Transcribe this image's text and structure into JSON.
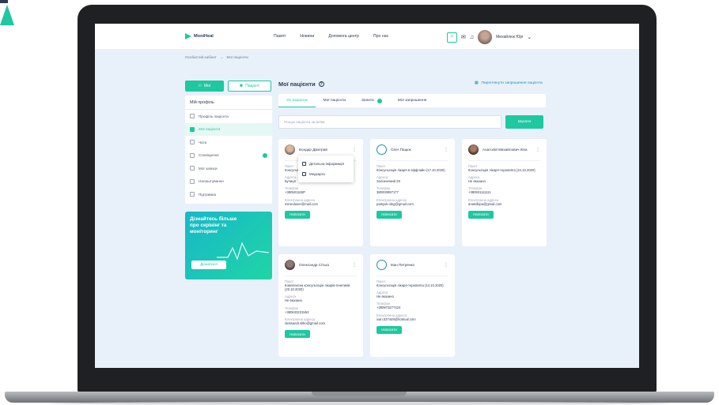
{
  "topbar": {
    "brand": "MoniHeal",
    "nav": [
      "Пакеті",
      "Новини",
      "Допомога центр",
      "Про нас"
    ],
    "user_name": "Михайлюк Юрі"
  },
  "breadcrumb": [
    "Особистий кабінет",
    "Мої пацієнти"
  ],
  "sidebar": {
    "btn_add": "Мої",
    "btn_second": "Пацієнт",
    "menu_title": "Мій профіль",
    "items": [
      {
        "label": "Профіль пацієнта",
        "active": false
      },
      {
        "label": "Мої пацієнти",
        "active": true
      },
      {
        "label": "Чати",
        "active": false
      },
      {
        "label": "Сповіщення",
        "active": false
      },
      {
        "label": "Мої записи",
        "active": false
      },
      {
        "label": "Налаштування",
        "active": false
      },
      {
        "label": "Підтримка",
        "active": false
      }
    ],
    "promo_title": "Дізнайтесь більше про скрінінг та моніторинг",
    "promo_button": "Дізнатися"
  },
  "main": {
    "title": "Мої пацієнти",
    "link": "Переглянути запрошення пацієнта",
    "tabs": [
      "Усі пацієнти",
      "Мої пацієнти",
      "Запити",
      "Мої запрошення"
    ],
    "search_placeholder": "Пошук пацієнта за ім'ям",
    "search_button": "Шукати"
  },
  "cards": [
    {
      "name": "Бондар Дмитрий",
      "f1_label": "Пакет",
      "f1": "Консультація (17.10.2020)",
      "f2_label": "Адреса",
      "f2": "Бучиця",
      "f3_label": "Телефон",
      "f3": "+380501165Р",
      "f4_label": "Електронна адреса",
      "f4": "mironduser@mail.com",
      "button": "Написати"
    },
    {
      "name": "Олег Пацюк",
      "f1_label": "Пакет",
      "f1": "Консультація лікаря в оффлайн (17.10.2020)",
      "f2_label": "Адреса",
      "f2": "Залізничний 29",
      "f3_label": "Телефон",
      "f3": "380000997177",
      "f4_label": "Електронна адреса",
      "f4": "patsyuk.oleg@gmail.com",
      "button": "Написати"
    },
    {
      "name": "Анатолій Михайлович Кіпа",
      "f1_label": "Пакет",
      "f1": "Консультація лікаря-терапевта (24.10.2020)",
      "f2_label": "Адреса",
      "f2": "Не вказано",
      "f3_label": "Телефон",
      "f3": "+380931111111",
      "f4_label": "Електронна адреса",
      "f4": "anatolkipa@gmail.com",
      "button": "Написати"
    },
    {
      "name": "Олександр Сітько",
      "f1_label": "Пакет",
      "f1": "Комплексна консультація лікарів-генетиків (20.10.2020)",
      "f2_label": "Адреса",
      "f2": "Не вказано",
      "f3_label": "Телефон",
      "f3": "+380633231553",
      "f4_label": "Електронна адреса",
      "f4": "oleksandr.sitko@gmail.com",
      "button": "Написати"
    },
    {
      "name": "Іван Петренко",
      "f1_label": "Пакет",
      "f1": "Консультація лікаря-терапевта (14.10.2020)",
      "f2_label": "Адреса",
      "f2": "Не вказано",
      "f3_label": "Телефон",
      "f3": "+380973277424",
      "f4_label": "Електронна адреса",
      "f4": "ivan.037449@hotmail.com",
      "button": "Написати"
    }
  ],
  "dropdown": [
    "Детальна інформація",
    "Медкарта"
  ],
  "colors": {
    "accent": "#1ec8a0",
    "background": "#e8f1fa",
    "laptop": "#1f2023"
  }
}
